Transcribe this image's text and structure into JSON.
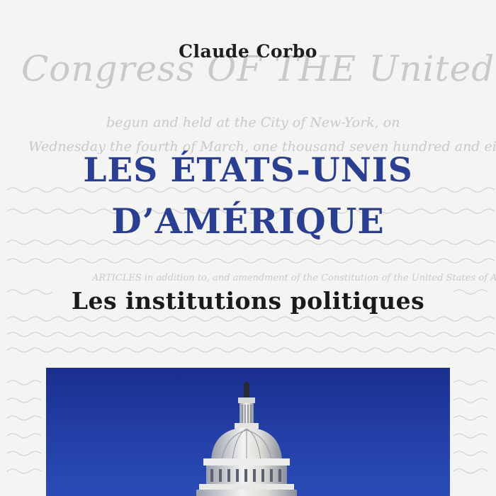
{
  "cover": {
    "author": "Claude Corbo",
    "title_line1": "LES ÉTATS-UNIS",
    "title_line2": "D’AMÉRIQUE",
    "subtitle": "Les institutions politiques"
  },
  "background_script": {
    "heading": "Congress OF THE United States",
    "line1": "begun and held at the City of New-York, on",
    "line2": "Wednesday the fourth of March, one thousand seven hundred and eighty nine",
    "line3": "ARTICLES in addition to, and amendment of the Constitution of the United States of America"
  },
  "colors": {
    "title": "#2a3f92",
    "sky": "#2440a8",
    "background": "#f4f4f2"
  },
  "icons": {
    "capitol": "capitol-dome-icon"
  }
}
